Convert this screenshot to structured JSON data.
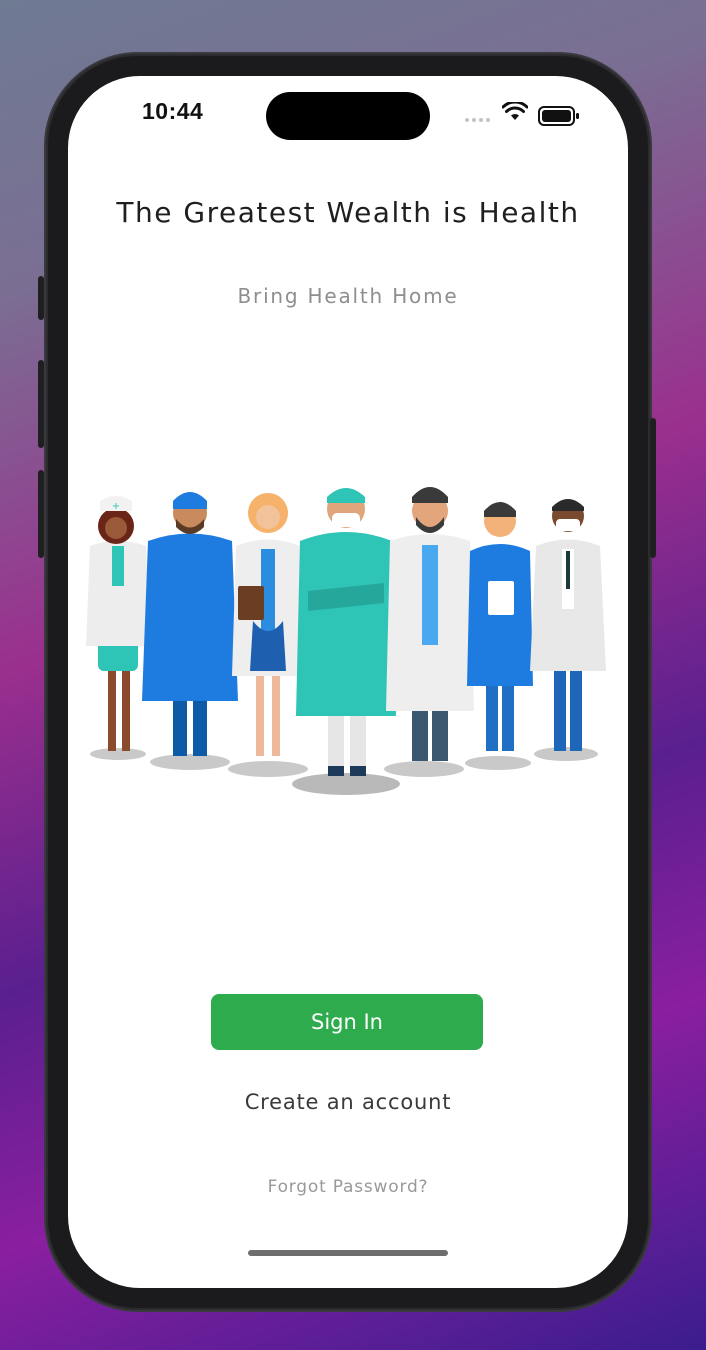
{
  "status_bar": {
    "time": "10:44"
  },
  "welcome": {
    "title": "The Greatest Wealth is Health",
    "subtitle": "Bring Health Home"
  },
  "illustration": {
    "icon": "medical-team-illustration"
  },
  "actions": {
    "sign_in_label": "Sign In",
    "create_account_label": "Create an account",
    "forgot_password_label": "Forgot Password?"
  },
  "colors": {
    "accent": "#2eab4d",
    "background": "#ffffff",
    "title_text": "#1f1f1f",
    "subtitle_text": "#8e8e8e"
  }
}
